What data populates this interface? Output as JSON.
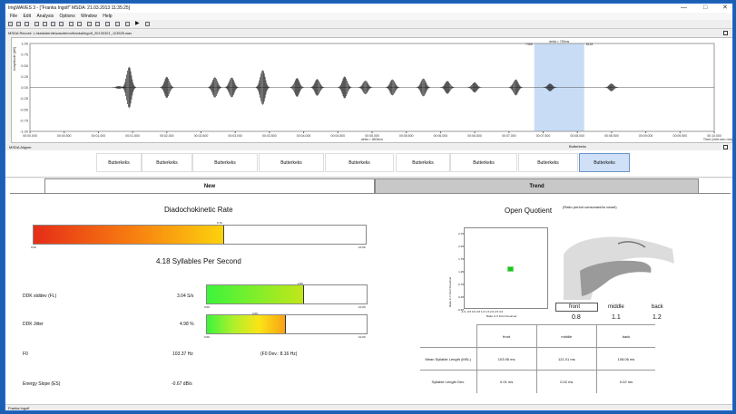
{
  "window": {
    "title": "ImgWAVES 3 - [\"Franka Ingolf\" MSDA: 21.03.2013 11:35:25]",
    "min_label": "—",
    "max_label": "□",
    "close_label": "✕"
  },
  "menu": [
    "File",
    "Edit",
    "Analysis",
    "Options",
    "Window",
    "Help"
  ],
  "record": {
    "label": "MSDA Record: L:\\data\\dentis\\wavdemo\\franka\\ingolf_20130321_113525.wav"
  },
  "waveform": {
    "ylabel": "Amplitude [dB]",
    "yticks": [
      "1.00",
      "0.75",
      "0.50",
      "0.25",
      "0.00",
      "-0.25",
      "-0.50",
      "-0.75",
      "-1.00"
    ],
    "xticks": [
      "00:00.000",
      "00:00.500",
      "00:01.000",
      "00:01.500",
      "00:02.000",
      "00:02.500",
      "00:03.000",
      "00:03.500",
      "00:04.000",
      "00:04.500",
      "00:05.000",
      "00:05.500",
      "00:06.000",
      "00:06.500",
      "00:07.000",
      "00:07.500",
      "00:08.000",
      "00:08.500",
      "00:09.000",
      "00:09.500",
      "00:10.000"
    ],
    "xlabel": "Time [min:sec.ms]",
    "sel_start": "7368",
    "sel_end": "8118",
    "sel_delta": "delta = 750ms",
    "cursor_label": "00:05.000",
    "cursor_delta": "delta = 3604ms",
    "selection": [
      0.737,
      0.81
    ]
  },
  "aligner": {
    "label": "MSDA Aligner",
    "selected_label": "Butterkeks",
    "segments": [
      "Butterkeks",
      "Butterkeks",
      "Butterkeks",
      "Butterkeks",
      "Butterkeks",
      "Butterkeks",
      "Butterkeks",
      "Butterkeks",
      "Butterkeks",
      "Butterkeks",
      "Butterkeks",
      "Butterkeks",
      "Butterkeks",
      "Butterkeks"
    ],
    "selected_index": 13
  },
  "tabs": {
    "new": "New",
    "trend": "Trend"
  },
  "ddk": {
    "title": "Diadochokinetic Rate",
    "min": "0.00",
    "max": "10.00",
    "marker": "5.70",
    "rate_fraction": 0.57,
    "syllables": "4.18 Syllables Per Second"
  },
  "metrics": {
    "stddev": {
      "label": "DDK stddev (FL)",
      "value": "3.04 S/s",
      "marker": "2.50",
      "fraction": 0.6
    },
    "jitter": {
      "label": "DDK Jitter",
      "value": "4.98 %",
      "marker": "3.00",
      "fraction": 0.49
    },
    "min": "0.00",
    "max": "10.00",
    "f0": {
      "label": "F0",
      "value": "103.37 Hz",
      "dev": "(F0 Dev.: 8.16 Hz)"
    },
    "es": {
      "label": "Energy Slope (ES)",
      "value": "-0.67 dB/s"
    }
  },
  "oq": {
    "title": "Open Quotient",
    "note": "(Ratio period consonant/to vowel)",
    "ylabel": "Ratio C-V front foreunner",
    "xlabel": "Ratio C-V front foreunner",
    "yticks": [
      "2.75",
      "2.25",
      "1.75",
      "1.25",
      "0.75",
      "0.25",
      "-0.25"
    ],
    "xticks": "-1.0 -0.5 0.0 0.5 1.0 1.5 2.0 2.5 3.0",
    "front_label": "front",
    "front_value": "0.8",
    "middle_label": "middle",
    "middle_value": "1.1",
    "back_label": "back",
    "back_value": "1.2"
  },
  "table": {
    "headers": [
      "",
      "front",
      "middle",
      "back"
    ],
    "rows": [
      [
        "Mean Syllable Length (MSL)",
        "103.96 ms",
        "121.01 ms",
        "108.06 ms"
      ],
      [
        "Syllable Length Dev.",
        "0.01 ms",
        "0.02 ms",
        "0.02 ms"
      ]
    ]
  },
  "status": "Franka Ingolf",
  "colors": {
    "selection": "#c8dcf5",
    "accent": "#1a5fb4"
  }
}
